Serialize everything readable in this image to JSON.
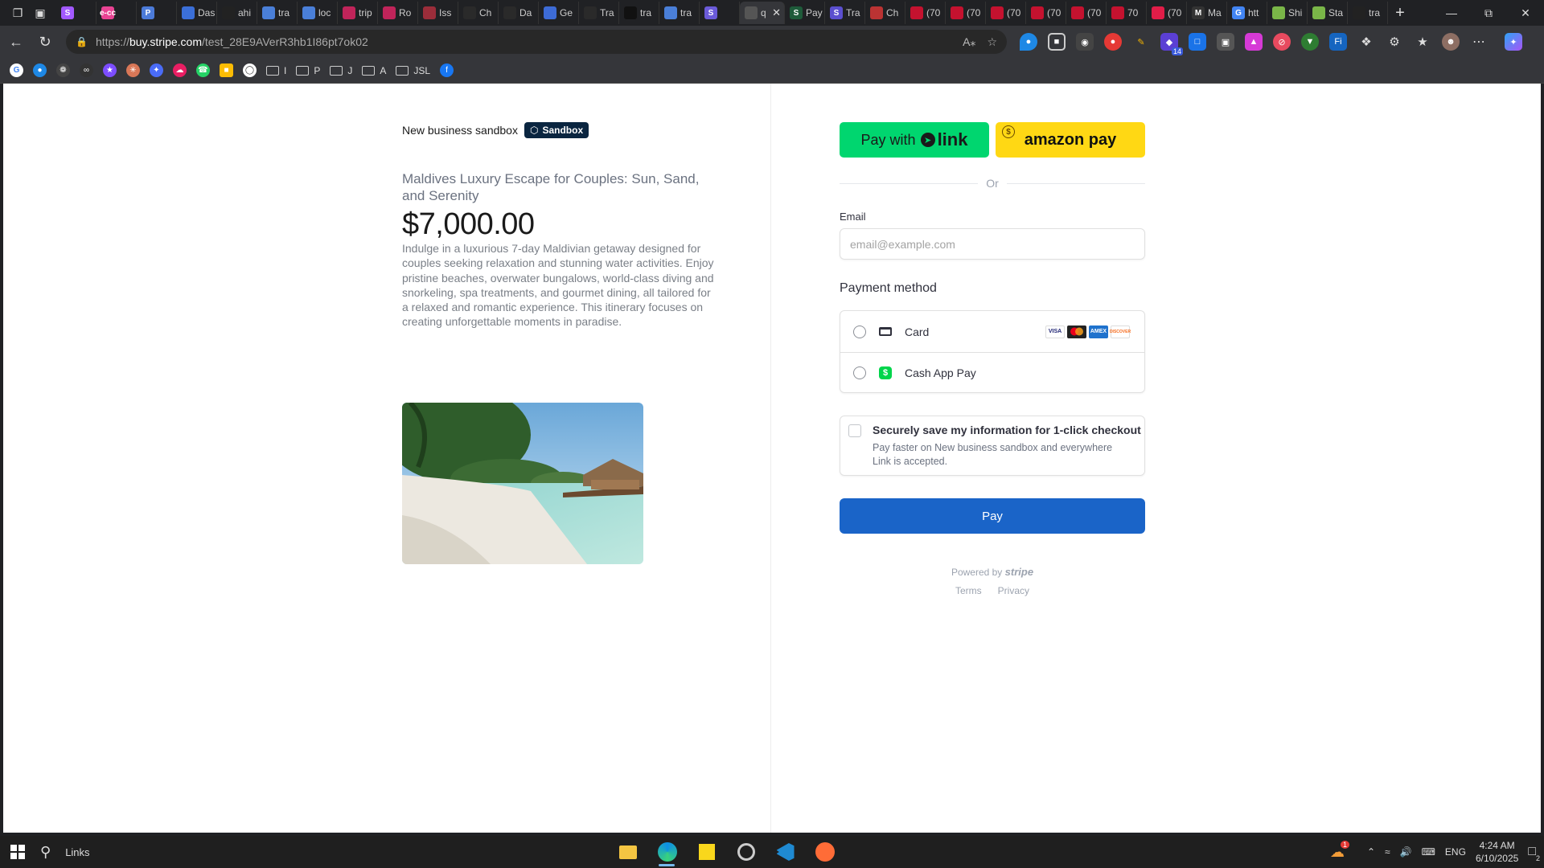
{
  "browser": {
    "tabs": [
      {
        "label": "",
        "fav": "S",
        "color": "#a259ff"
      },
      {
        "label": "",
        "fav": "e-cc",
        "color": "#e84393"
      },
      {
        "label": "",
        "fav": "P",
        "color": "#4c7bd9"
      },
      {
        "label": "Das",
        "fav": "",
        "color": "#3b6fd8"
      },
      {
        "label": "ahi",
        "fav": "",
        "color": "#222"
      },
      {
        "label": "tra",
        "fav": "",
        "color": "#4a7fd8"
      },
      {
        "label": "loc",
        "fav": "",
        "color": "#4a7fd8"
      },
      {
        "label": "trip",
        "fav": "",
        "color": "#c0245a"
      },
      {
        "label": "Ro",
        "fav": "",
        "color": "#c0245a"
      },
      {
        "label": "Iss",
        "fav": "",
        "color": "#9b2d3a"
      },
      {
        "label": "Ch",
        "fav": "",
        "color": "#2a2a2a"
      },
      {
        "label": "Da",
        "fav": "",
        "color": "#2a2a2a"
      },
      {
        "label": "Ge",
        "fav": "",
        "color": "#3d6bd6"
      },
      {
        "label": "Tra",
        "fav": "",
        "color": "#2a2a2a"
      },
      {
        "label": "tra",
        "fav": "",
        "color": "#111"
      },
      {
        "label": "tra",
        "fav": "",
        "color": "#4a7fd8"
      },
      {
        "label": "",
        "fav": "S",
        "color": "#6b5bd9"
      },
      {
        "label": "q",
        "fav": "",
        "color": "#555",
        "active": true
      },
      {
        "label": "Pay",
        "fav": "S",
        "color": "#1e5b3a"
      },
      {
        "label": "Tra",
        "fav": "S",
        "color": "#5b4fcf"
      },
      {
        "label": "Ch",
        "fav": "",
        "color": "#b33"
      },
      {
        "label": "(70",
        "fav": "",
        "color": "#c4122f"
      },
      {
        "label": "(70",
        "fav": "",
        "color": "#c4122f"
      },
      {
        "label": "(70",
        "fav": "",
        "color": "#c4122f"
      },
      {
        "label": "(70",
        "fav": "",
        "color": "#c4122f"
      },
      {
        "label": "(70",
        "fav": "",
        "color": "#c4122f"
      },
      {
        "label": "70",
        "fav": "",
        "color": "#c4122f"
      },
      {
        "label": "(70",
        "fav": "",
        "color": "#e11d48"
      },
      {
        "label": "Ma",
        "fav": "M",
        "color": "#333"
      },
      {
        "label": "htt",
        "fav": "G",
        "color": "#4285f4"
      },
      {
        "label": "Shi",
        "fav": "",
        "color": "#7ab648"
      },
      {
        "label": "Sta",
        "fav": "",
        "color": "#7ab648"
      },
      {
        "label": "tra",
        "fav": "",
        "color": "#222"
      }
    ],
    "url_prefix": "https://",
    "url_host": "buy.stripe.com",
    "url_path": "/test_28E9AVerR3hb1I86pt7ok02",
    "bookmark_folders": [
      "I",
      "P",
      "J",
      "A",
      "JSL"
    ],
    "extension_badge": "14"
  },
  "merchant": {
    "name": "New business sandbox",
    "badge": "Sandbox"
  },
  "product": {
    "name": "Maldives Luxury Escape for Couples: Sun, Sand, and Serenity",
    "price": "$7,000.00",
    "description": "Indulge in a luxurious 7-day Maldivian getaway designed for couples seeking relaxation and stunning water activities. Enjoy pristine beaches, overwater bungalows, world-class diving and snorkeling, spa treatments, and gourmet dining, all tailored for a relaxed and romantic experience. This itinerary focuses on creating unforgettable moments in paradise."
  },
  "checkout": {
    "link_button_prefix": "Pay with",
    "link_logo": "link",
    "amazon_label": "amazon pay",
    "or_text": "Or",
    "email_label": "Email",
    "email_placeholder": "email@example.com",
    "payment_method_title": "Payment method",
    "methods": [
      {
        "label": "Card",
        "brands": [
          "VISA",
          "MC",
          "AMEX",
          "DISCOVER"
        ]
      },
      {
        "label": "Cash App Pay"
      }
    ],
    "save_title": "Securely save my information for 1-click checkout",
    "save_subtitle": "Pay faster on New business sandbox and everywhere Link is accepted.",
    "pay_label": "Pay",
    "powered_by": "Powered by",
    "powered_brand": "stripe",
    "footer_links": [
      "Terms",
      "Privacy"
    ]
  },
  "taskbar": {
    "search_label": "Links",
    "language": "ENG",
    "time": "4:24 AM",
    "date": "6/10/2025",
    "notification_count": "2",
    "weather_badge": "1"
  }
}
